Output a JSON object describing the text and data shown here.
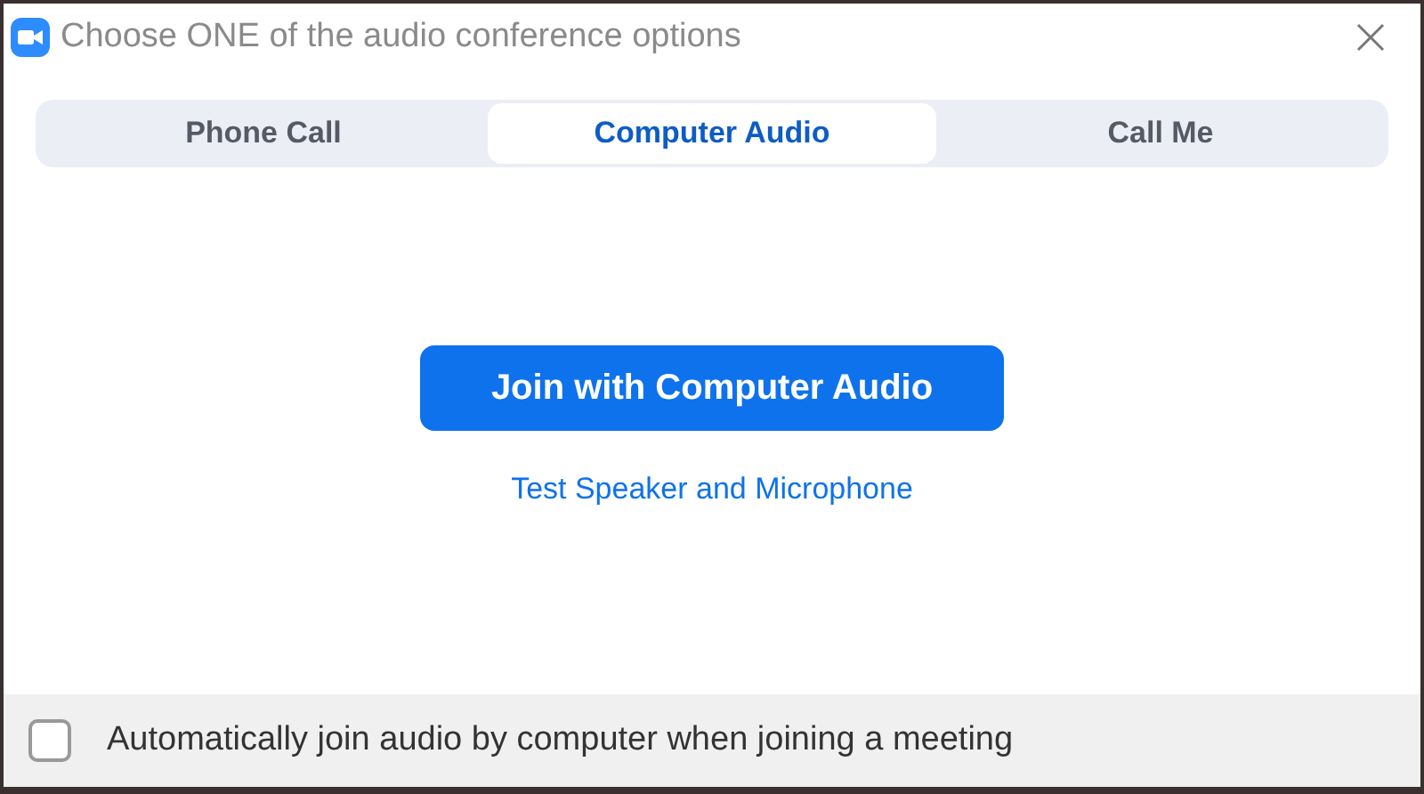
{
  "window": {
    "title": "Choose ONE of the audio conference options"
  },
  "tabs": [
    {
      "label": "Phone Call",
      "selected": false
    },
    {
      "label": "Computer Audio",
      "selected": true
    },
    {
      "label": "Call Me",
      "selected": false
    }
  ],
  "join_button": {
    "label": "Join with Computer Audio"
  },
  "test_link": {
    "label": "Test Speaker and Microphone"
  },
  "auto_join": {
    "label": "Automatically join audio by computer when joining a meeting",
    "checked": false
  }
}
